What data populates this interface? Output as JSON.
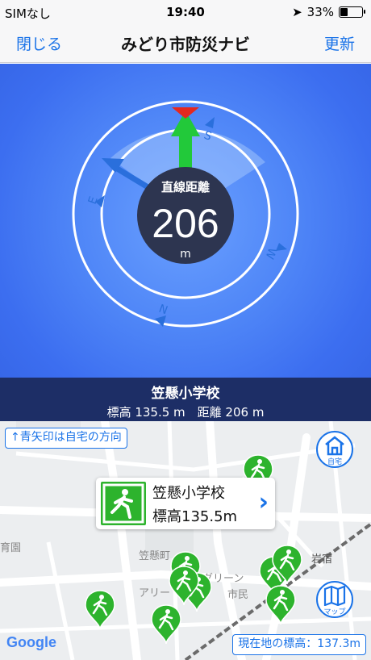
{
  "status": {
    "carrier": "SIMなし",
    "time": "19:40",
    "battery": "33%",
    "battery_level": 0.33
  },
  "nav": {
    "close": "閉じる",
    "title": "みどり市防災ナビ",
    "refresh": "更新"
  },
  "compass": {
    "label": "直線距離",
    "distance": "206",
    "unit": "m",
    "directions": [
      "S",
      "E",
      "W",
      "N"
    ]
  },
  "destination": {
    "name": "笠懸小学校",
    "info": "標高 135.5 m　距離 206 m"
  },
  "map": {
    "hint": "↑青矢印は自宅の方向",
    "home_label": "自宅",
    "map_label": "マップ",
    "popup": {
      "name": "笠懸小学校",
      "elevation": "標高135.5m"
    },
    "current_elevation": "現在地の標高：137.3m",
    "logo": "Google",
    "place_labels": [
      "育園",
      "笠懸町",
      "岩宿",
      "アリー",
      "学グリーン",
      "市民"
    ]
  },
  "colors": {
    "accent": "#1a73e8",
    "shelter_green": "#2db32d",
    "header_navy": "#1d2e66"
  }
}
